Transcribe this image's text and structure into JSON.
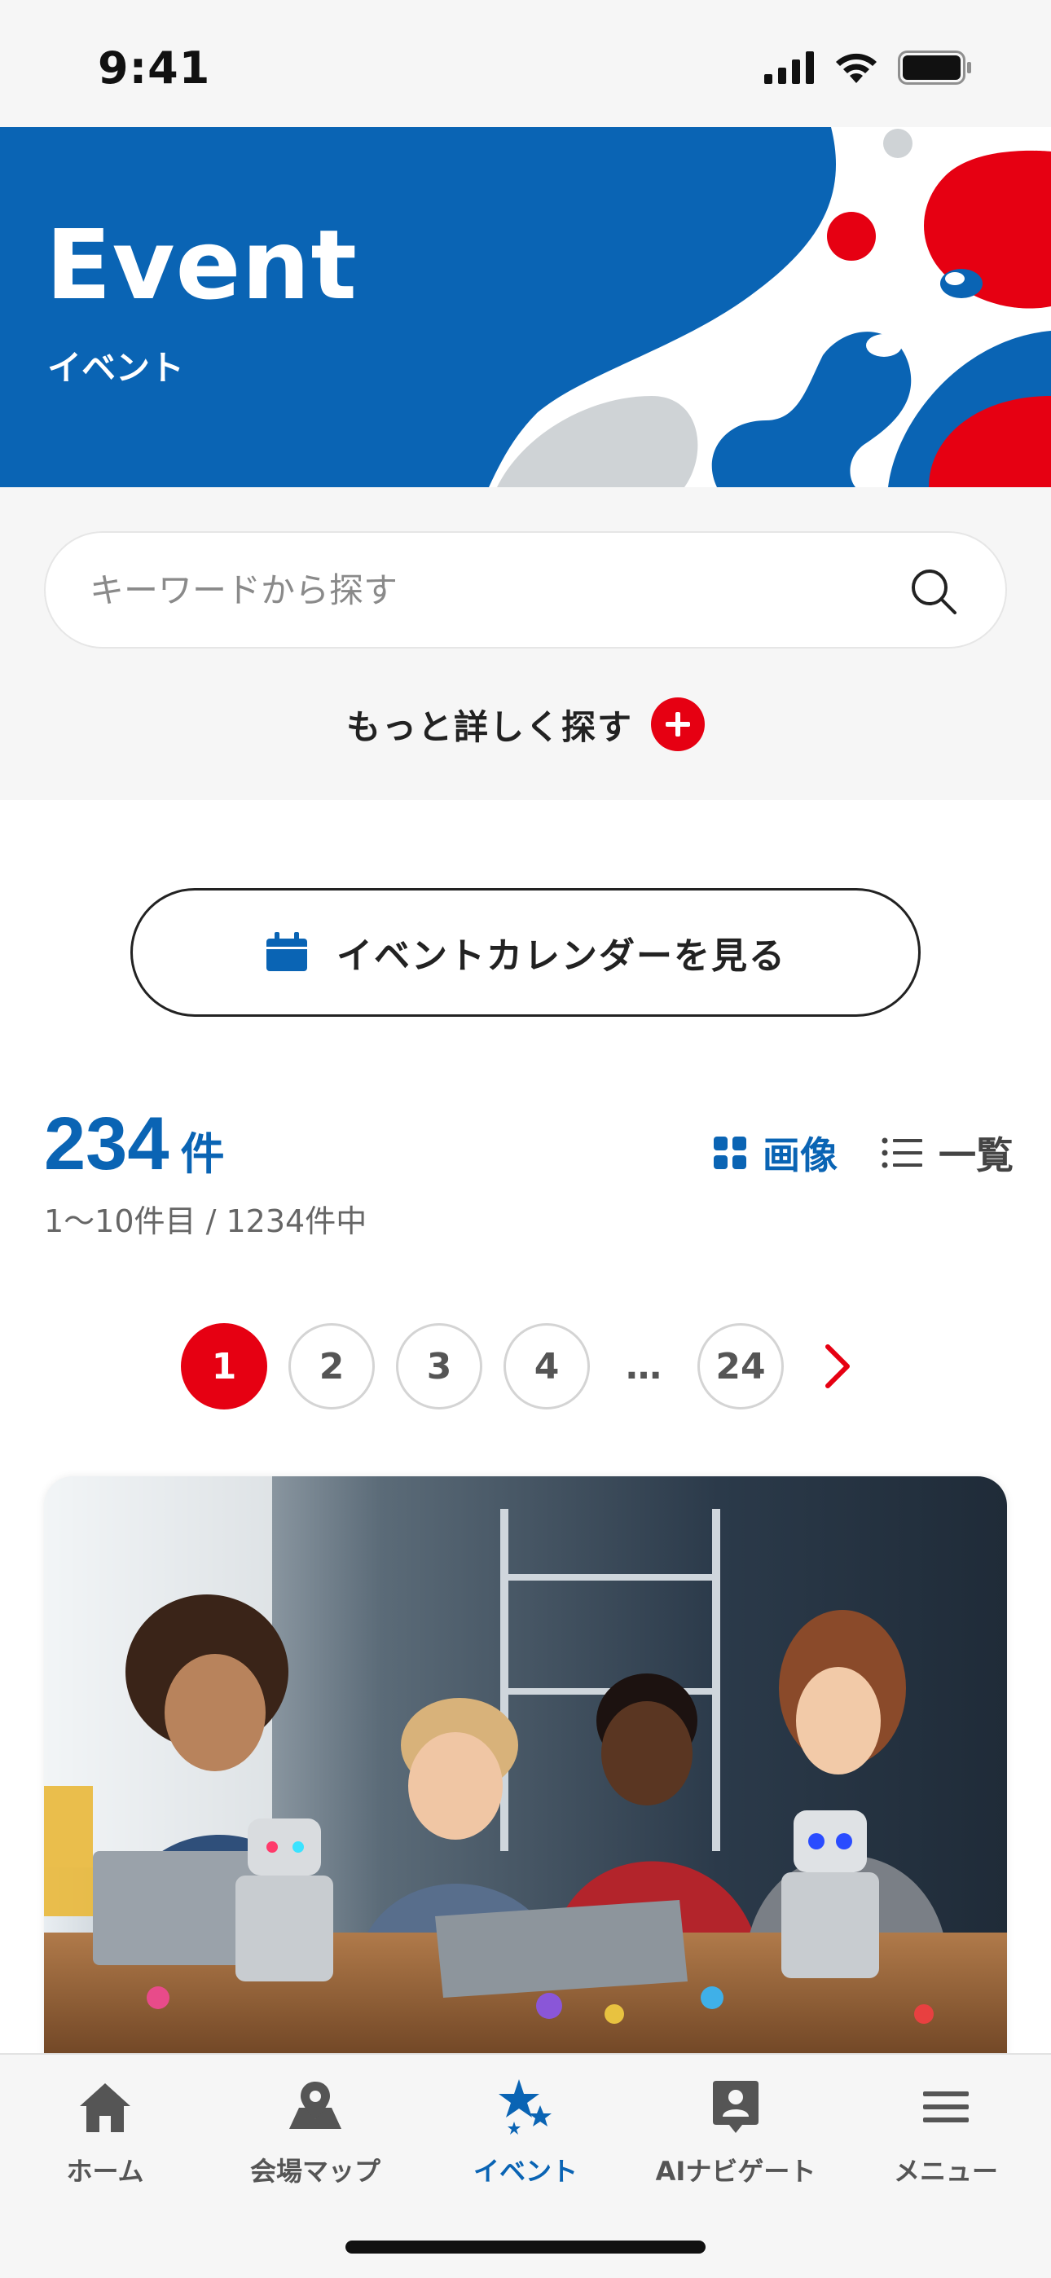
{
  "status_bar": {
    "time": "9:41"
  },
  "hero": {
    "title": "Event",
    "subtitle": "イベント"
  },
  "search": {
    "placeholder": "キーワードから探す",
    "advanced_label": "もっと詳しく探す"
  },
  "calendar_button": {
    "label": "イベントカレンダーを見る"
  },
  "results": {
    "count": "234",
    "unit": "件",
    "range_text": "1〜10件目 / 1234件中",
    "view_image_label": "画像",
    "view_list_label": "一覧"
  },
  "pagination": {
    "pages": [
      "1",
      "2",
      "3",
      "4",
      "24"
    ],
    "current": "1",
    "ellipsis": "…"
  },
  "bottom_nav": {
    "items": [
      {
        "label": "ホーム",
        "icon": "home-icon"
      },
      {
        "label": "会場マップ",
        "icon": "map-icon"
      },
      {
        "label": "イベント",
        "icon": "event-stars-icon"
      },
      {
        "label": "AIナビゲート",
        "icon": "ai-navigate-icon"
      },
      {
        "label": "メニュー",
        "icon": "menu-icon"
      }
    ],
    "active_index": 2
  },
  "colors": {
    "brand_blue": "#0a64b4",
    "accent_red": "#e60012",
    "background_gray": "#f6f6f6"
  }
}
